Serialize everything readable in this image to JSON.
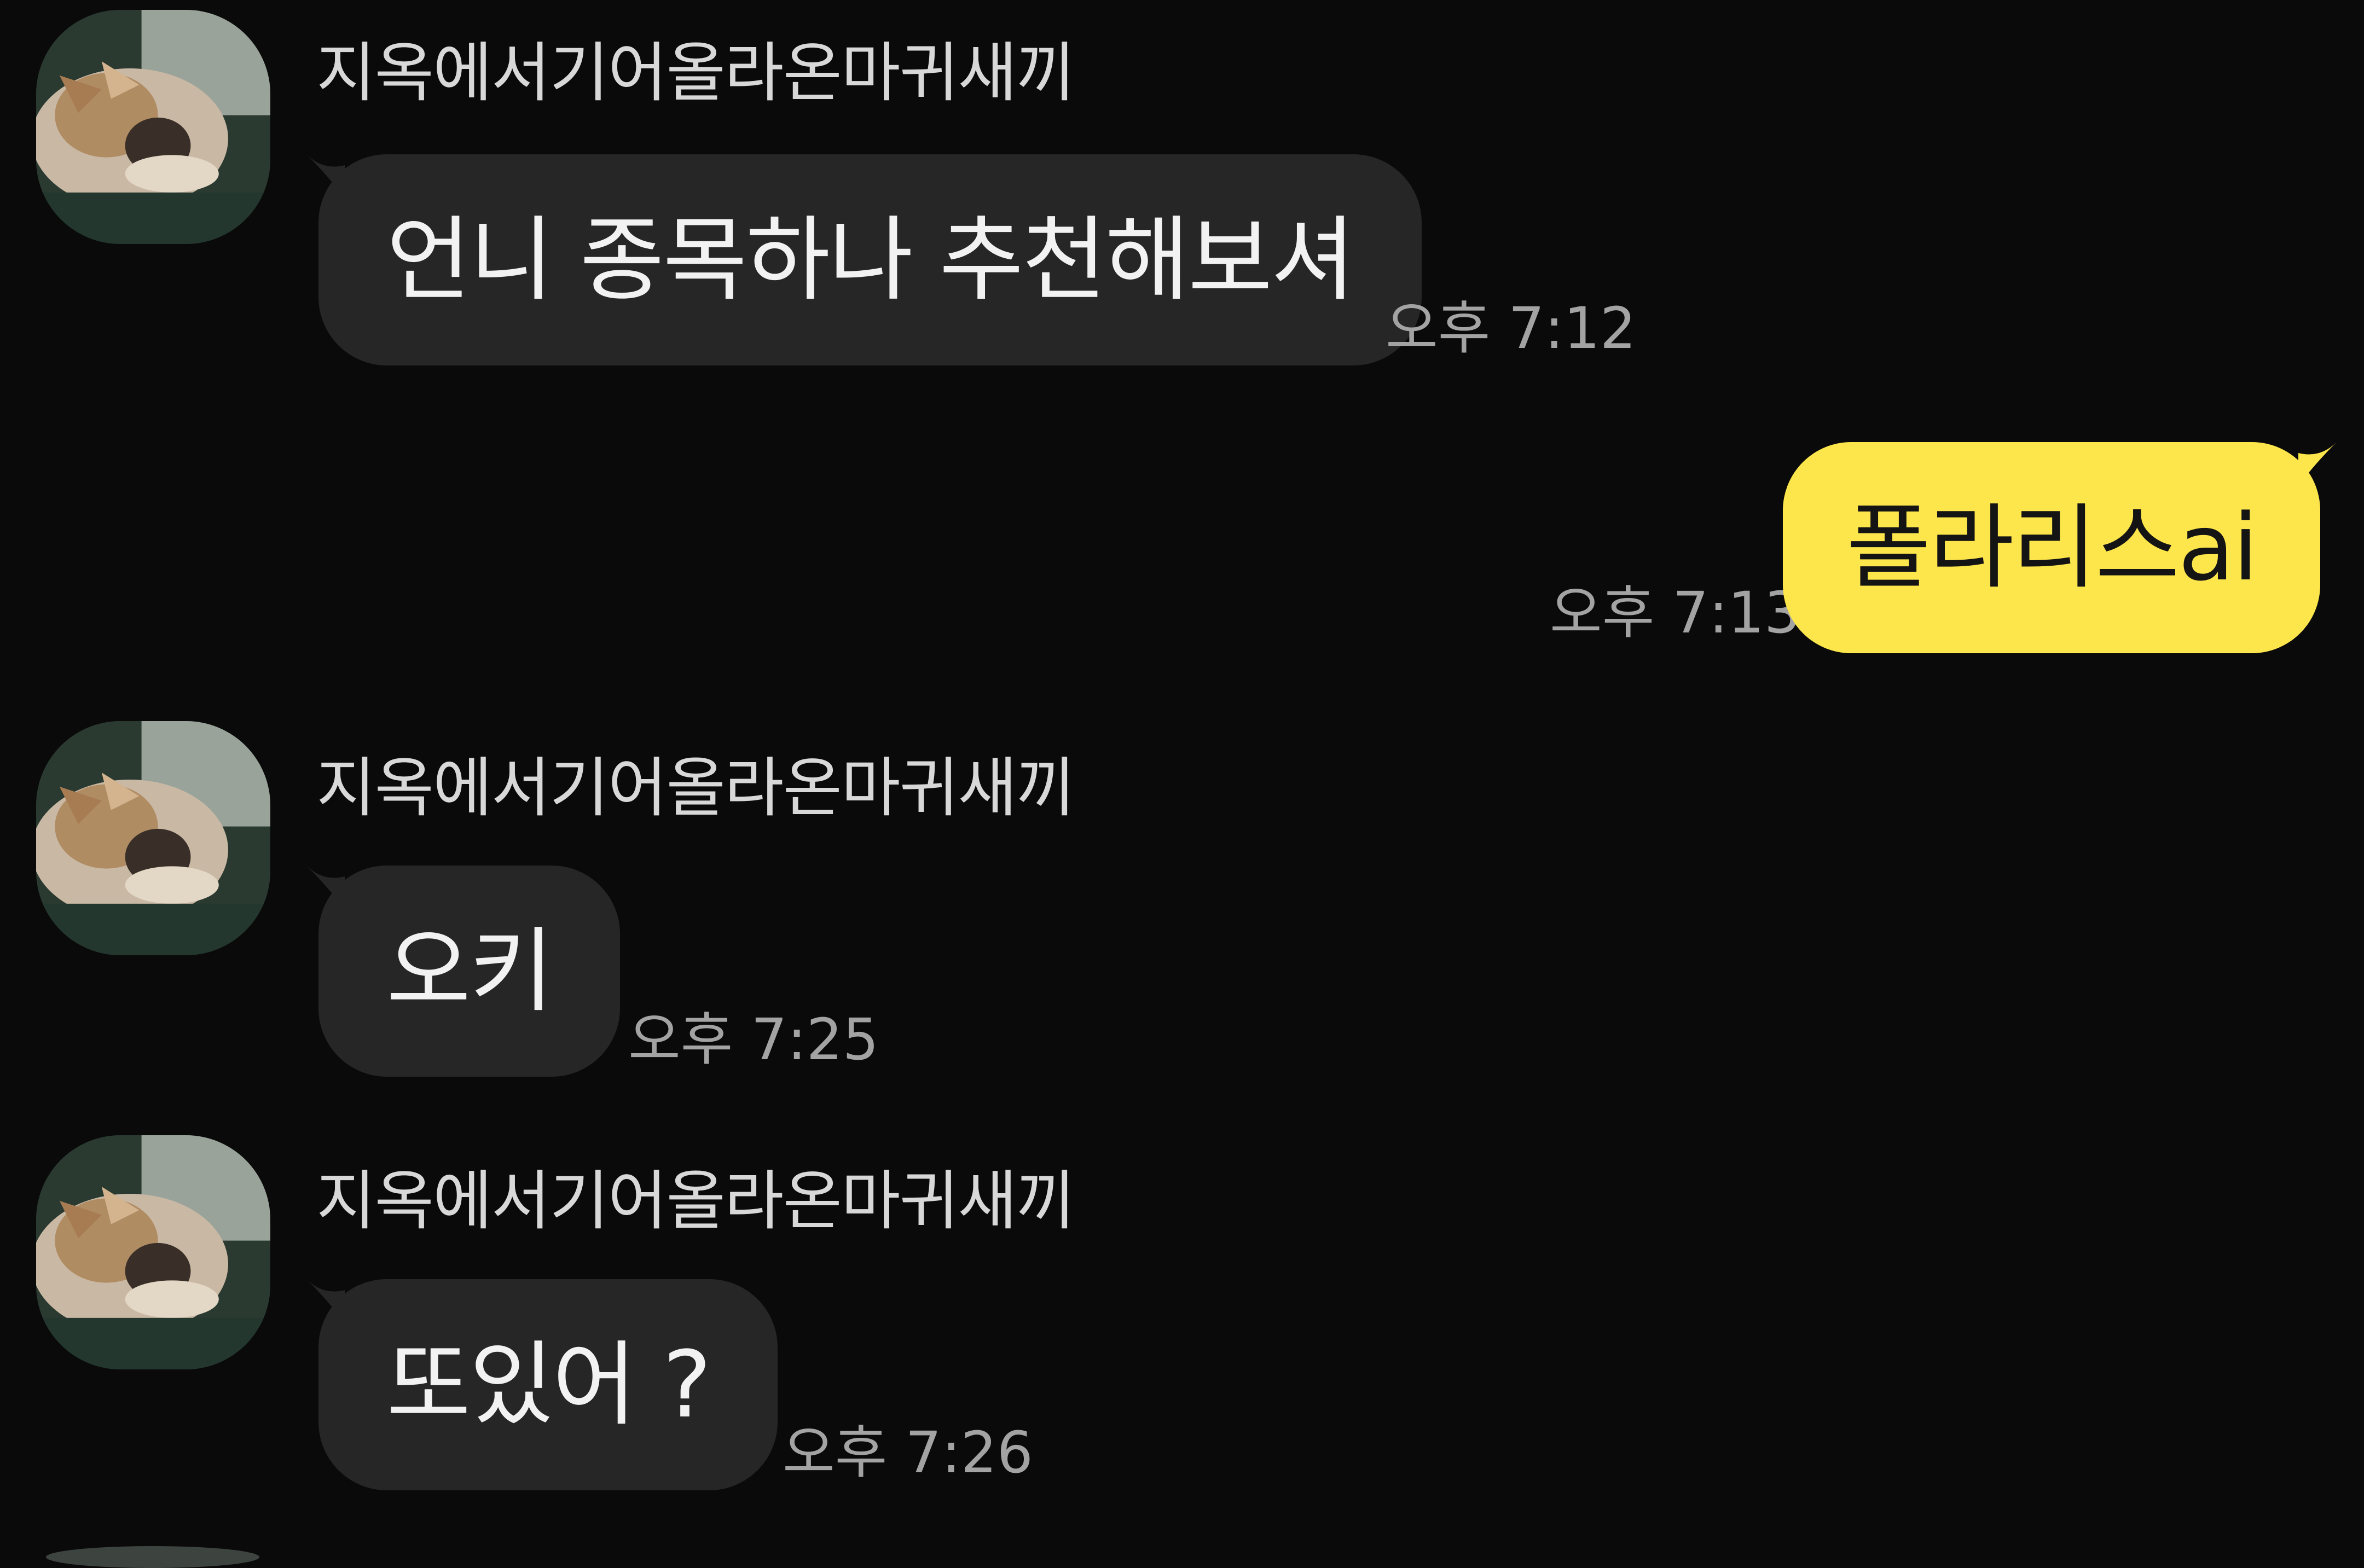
{
  "conversation": {
    "messages": [
      {
        "sender": "지옥에서기어올라온마귀새끼",
        "text": "언니 종목하나 추천해보셔",
        "time": "오후 7:12"
      },
      {
        "text": "폴라리스ai",
        "time": "오후 7:13"
      },
      {
        "sender": "지옥에서기어올라온마귀새끼",
        "text": "오키",
        "time": "오후 7:25"
      },
      {
        "sender": "지옥에서기어올라온마귀새끼",
        "text": "또있어 ?",
        "time": "오후 7:26"
      }
    ]
  },
  "colors": {
    "background": "#0a0a0a",
    "incoming_bubble": "#262626",
    "outgoing_bubble": "#fde64b",
    "timestamp": "#a3a3a3"
  },
  "icons": {
    "avatar": "profile-photo-dog"
  }
}
